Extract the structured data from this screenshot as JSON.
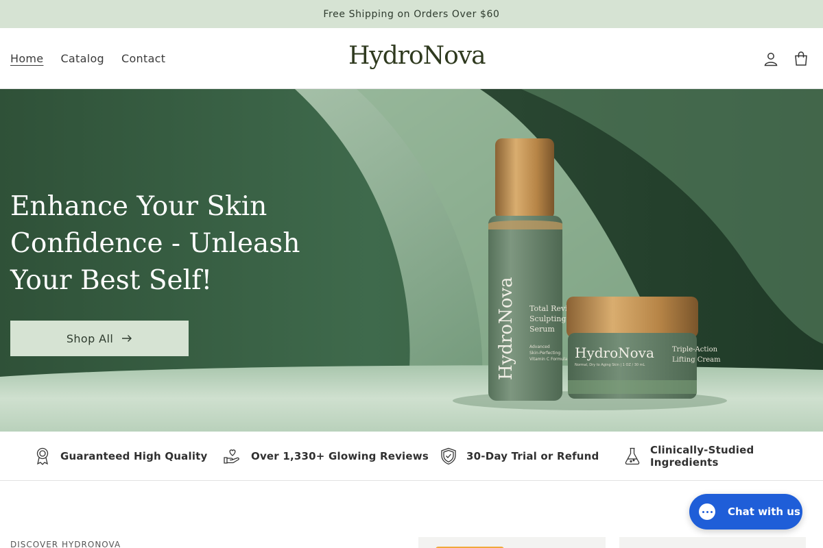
{
  "announcement": "Free Shipping on Orders Over $60",
  "nav": {
    "home": "Home",
    "catalog": "Catalog",
    "contact": "Contact"
  },
  "logo": "HydroNova",
  "icons": {
    "account": "account-icon",
    "cart": "cart-icon"
  },
  "hero": {
    "title": "Enhance Your Skin Confidence - Unleash Your Best Self!",
    "button_label": "Shop All",
    "serum_brand": "HydroNova",
    "serum_label": "Total Revive Sculpting Serum",
    "serum_fine": "Advanced Skin-Perfecting Vitamin C Formula",
    "jar_brand": "HydroNova",
    "jar_label": "Triple-Action Lifting Cream",
    "jar_fine": "Normal, Dry to Aging Skin | 1 OZ / 30 mL"
  },
  "features": [
    {
      "icon": "award-ribbon-icon",
      "label": "Guaranteed High Quality"
    },
    {
      "icon": "hand-heart-icon",
      "label": "Over 1,330+ Glowing Reviews"
    },
    {
      "icon": "shield-check-icon",
      "label": "30-Day Trial or Refund"
    },
    {
      "icon": "flask-icon",
      "label": "Clinically-Studied Ingredients"
    }
  ],
  "discover_label": "DISCOVER HYDRONOVA",
  "chat": {
    "label": "Chat with us"
  },
  "colors": {
    "announce_bg": "#d6e3d3",
    "hero_green": "#36593f",
    "chat_blue": "#1f5ed8",
    "gold": "#c99a5c"
  }
}
